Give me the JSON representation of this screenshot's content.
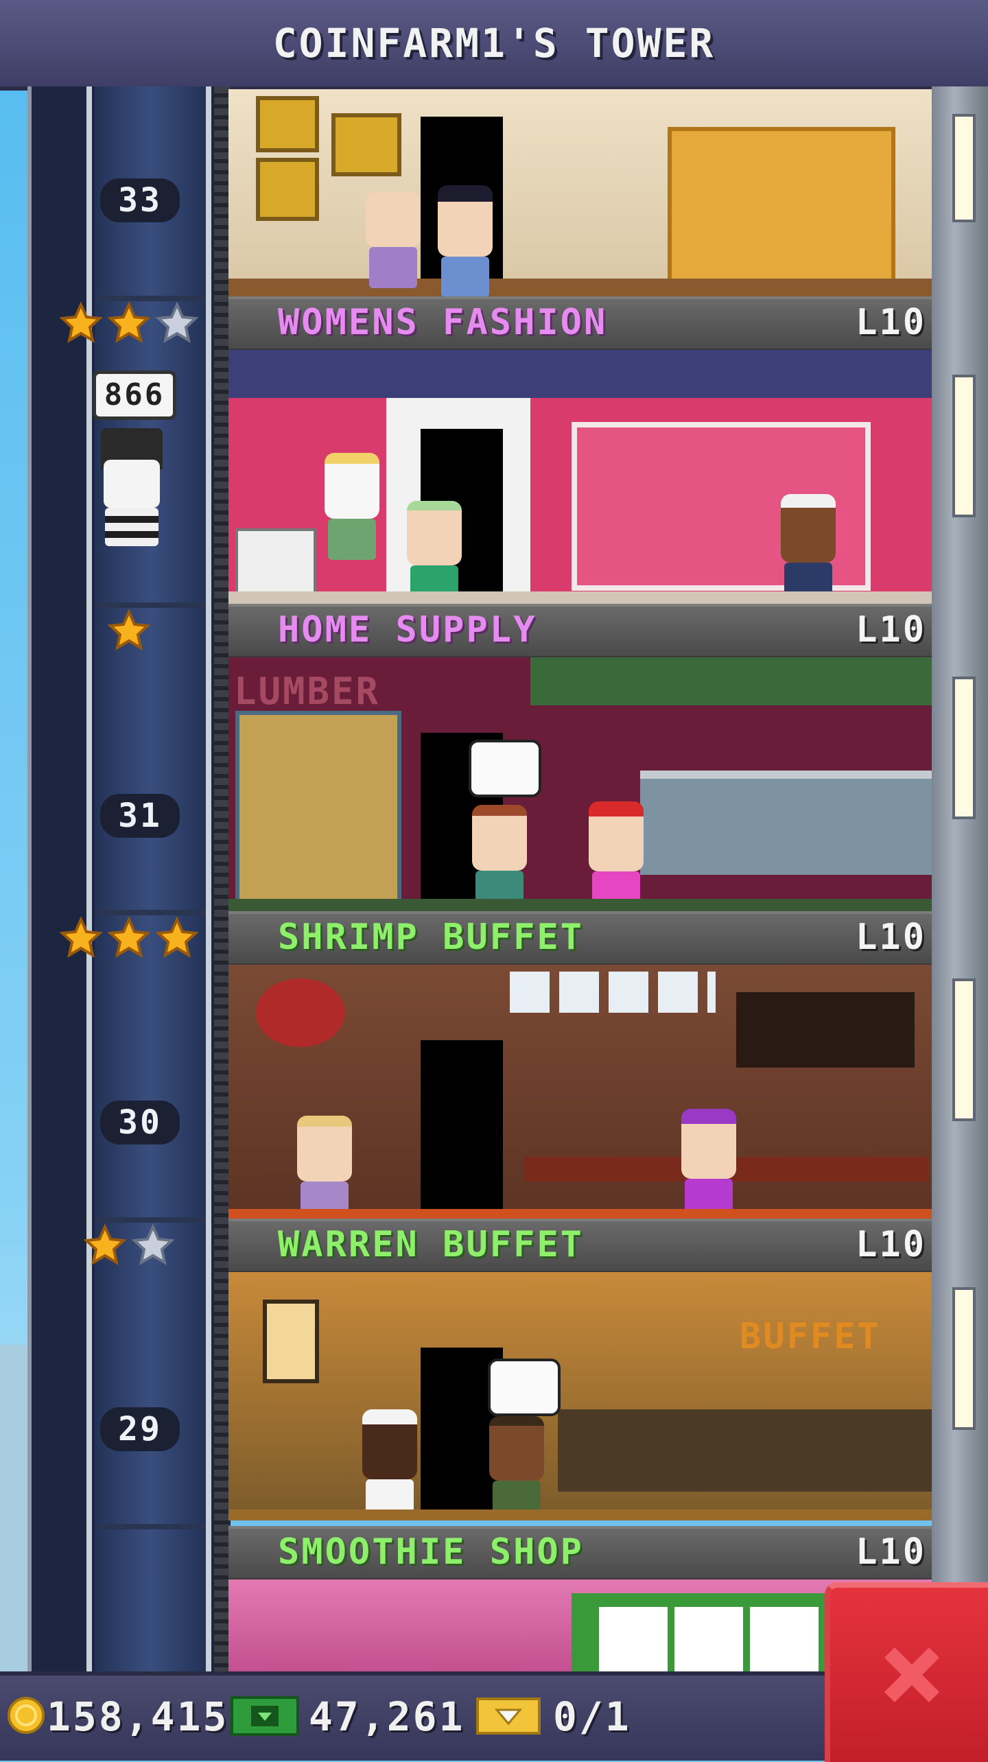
{
  "header": {
    "title": "COINFARM1'S TOWER"
  },
  "elevator": {
    "floor_numbers": [
      "33",
      "31",
      "30",
      "29"
    ],
    "bitizen_sign": "866"
  },
  "floors": [
    {
      "name": "WOMENS FASHION",
      "level": "L10",
      "stars_filled": 2,
      "stars_total": 3,
      "category_color": "#e68cf0"
    },
    {
      "name": "HOME SUPPLY",
      "level": "L10",
      "stars_filled": 1,
      "stars_total": 1,
      "category_color": "#e68cf0",
      "sign": "LUMBER"
    },
    {
      "name": "SHRIMP BUFFET",
      "level": "L10",
      "stars_filled": 3,
      "stars_total": 3,
      "category_color": "#8ef06a"
    },
    {
      "name": "WARREN BUFFET",
      "level": "L10",
      "stars_filled": 1,
      "stars_total": 2,
      "category_color": "#8ef06a",
      "sign": "BUFFET"
    },
    {
      "name": "SMOOTHIE SHOP",
      "level": "L10",
      "category_color": "#8ef06a"
    }
  ],
  "currency": {
    "coins": "158,415",
    "bux": "47,261",
    "tickets": "0/1",
    "coin_icon": "gold-coin-icon",
    "bux_icon": "green-bux-icon",
    "ticket_icon": "golden-ticket-icon"
  },
  "close_button": {
    "icon": "close-x-icon",
    "color": "#d62b35"
  }
}
